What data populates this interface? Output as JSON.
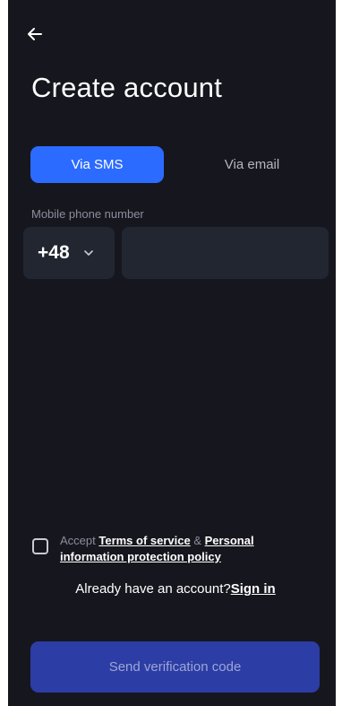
{
  "header": {
    "back_icon": "arrow-left-icon",
    "title": "Create account"
  },
  "tabs": [
    {
      "label": "Via SMS",
      "active": true
    },
    {
      "label": "Via email",
      "active": false
    }
  ],
  "phone": {
    "label": "Mobile phone number",
    "country_code": "+48",
    "chevron_icon": "chevron-down-icon",
    "value": ""
  },
  "consent": {
    "checked": false,
    "prefix": "Accept ",
    "terms_link": "Terms of service",
    "separator": " & ",
    "privacy_link": "Personal information protection policy"
  },
  "signin": {
    "text": "Already have an account?",
    "link": "Sign in"
  },
  "send_button": {
    "label": "Send verification code"
  },
  "colors": {
    "background": "#16161e",
    "accent": "#2c6bff",
    "field": "#222631",
    "button_disabled": "#2c3da6"
  }
}
